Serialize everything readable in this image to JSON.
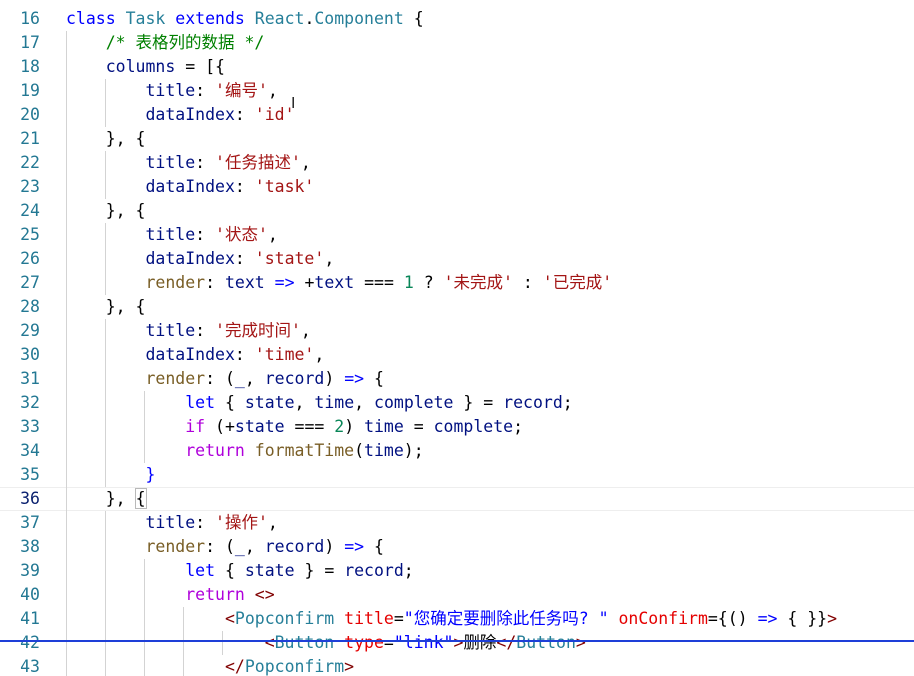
{
  "editor": {
    "cursor_glyph": "I",
    "lines": [
      {
        "n": "16",
        "current": false,
        "tokens": [
          {
            "t": "class ",
            "c": "t-kw"
          },
          {
            "t": "Task ",
            "c": "t-cls"
          },
          {
            "t": "extends ",
            "c": "t-kw"
          },
          {
            "t": "React",
            "c": "t-cls"
          },
          {
            "t": ".",
            "c": "t-p"
          },
          {
            "t": "Component",
            "c": "t-cls"
          },
          {
            "t": " {",
            "c": "t-p"
          }
        ]
      },
      {
        "n": "17",
        "current": false,
        "tokens": [
          {
            "t": "    ",
            "c": "t-p"
          },
          {
            "t": "/* 表格列的数据 */",
            "c": "t-cm"
          }
        ]
      },
      {
        "n": "18",
        "current": false,
        "tokens": [
          {
            "t": "    ",
            "c": "t-p"
          },
          {
            "t": "columns",
            "c": "t-prop"
          },
          {
            "t": " = [{",
            "c": "t-p"
          }
        ]
      },
      {
        "n": "19",
        "current": false,
        "tokens": [
          {
            "t": "        ",
            "c": "t-p"
          },
          {
            "t": "title",
            "c": "t-prop"
          },
          {
            "t": ": ",
            "c": "t-p"
          },
          {
            "t": "'编号'",
            "c": "t-str"
          },
          {
            "t": ",",
            "c": "t-p"
          }
        ]
      },
      {
        "n": "20",
        "current": false,
        "tokens": [
          {
            "t": "        ",
            "c": "t-p"
          },
          {
            "t": "dataIndex",
            "c": "t-prop"
          },
          {
            "t": ": ",
            "c": "t-p"
          },
          {
            "t": "'id'",
            "c": "t-str"
          }
        ]
      },
      {
        "n": "21",
        "current": false,
        "tokens": [
          {
            "t": "    ",
            "c": "t-p"
          },
          {
            "t": "}, {",
            "c": "t-p"
          }
        ]
      },
      {
        "n": "22",
        "current": false,
        "tokens": [
          {
            "t": "        ",
            "c": "t-p"
          },
          {
            "t": "title",
            "c": "t-prop"
          },
          {
            "t": ": ",
            "c": "t-p"
          },
          {
            "t": "'任务描述'",
            "c": "t-str"
          },
          {
            "t": ",",
            "c": "t-p"
          }
        ]
      },
      {
        "n": "23",
        "current": false,
        "tokens": [
          {
            "t": "        ",
            "c": "t-p"
          },
          {
            "t": "dataIndex",
            "c": "t-prop"
          },
          {
            "t": ": ",
            "c": "t-p"
          },
          {
            "t": "'task'",
            "c": "t-str"
          }
        ]
      },
      {
        "n": "24",
        "current": false,
        "tokens": [
          {
            "t": "    ",
            "c": "t-p"
          },
          {
            "t": "}, {",
            "c": "t-p"
          }
        ]
      },
      {
        "n": "25",
        "current": false,
        "tokens": [
          {
            "t": "        ",
            "c": "t-p"
          },
          {
            "t": "title",
            "c": "t-prop"
          },
          {
            "t": ": ",
            "c": "t-p"
          },
          {
            "t": "'状态'",
            "c": "t-str"
          },
          {
            "t": ",",
            "c": "t-p"
          }
        ]
      },
      {
        "n": "26",
        "current": false,
        "tokens": [
          {
            "t": "        ",
            "c": "t-p"
          },
          {
            "t": "dataIndex",
            "c": "t-prop"
          },
          {
            "t": ": ",
            "c": "t-p"
          },
          {
            "t": "'state'",
            "c": "t-str"
          },
          {
            "t": ",",
            "c": "t-p"
          }
        ]
      },
      {
        "n": "27",
        "current": false,
        "tokens": [
          {
            "t": "        ",
            "c": "t-p"
          },
          {
            "t": "render",
            "c": "t-fn"
          },
          {
            "t": ": ",
            "c": "t-p"
          },
          {
            "t": "text",
            "c": "t-prop"
          },
          {
            "t": " => ",
            "c": "t-kw"
          },
          {
            "t": "+",
            "c": "t-p"
          },
          {
            "t": "text",
            "c": "t-prop"
          },
          {
            "t": " === ",
            "c": "t-p"
          },
          {
            "t": "1",
            "c": "t-num"
          },
          {
            "t": " ? ",
            "c": "t-p"
          },
          {
            "t": "'未完成'",
            "c": "t-str"
          },
          {
            "t": " : ",
            "c": "t-p"
          },
          {
            "t": "'已完成'",
            "c": "t-str"
          }
        ]
      },
      {
        "n": "28",
        "current": false,
        "tokens": [
          {
            "t": "    ",
            "c": "t-p"
          },
          {
            "t": "}, {",
            "c": "t-p"
          }
        ]
      },
      {
        "n": "29",
        "current": false,
        "tokens": [
          {
            "t": "        ",
            "c": "t-p"
          },
          {
            "t": "title",
            "c": "t-prop"
          },
          {
            "t": ": ",
            "c": "t-p"
          },
          {
            "t": "'完成时间'",
            "c": "t-str"
          },
          {
            "t": ",",
            "c": "t-p"
          }
        ]
      },
      {
        "n": "30",
        "current": false,
        "tokens": [
          {
            "t": "        ",
            "c": "t-p"
          },
          {
            "t": "dataIndex",
            "c": "t-prop"
          },
          {
            "t": ": ",
            "c": "t-p"
          },
          {
            "t": "'time'",
            "c": "t-str"
          },
          {
            "t": ",",
            "c": "t-p"
          }
        ]
      },
      {
        "n": "31",
        "current": false,
        "tokens": [
          {
            "t": "        ",
            "c": "t-p"
          },
          {
            "t": "render",
            "c": "t-fn"
          },
          {
            "t": ": (",
            "c": "t-p"
          },
          {
            "t": "_",
            "c": "t-prop"
          },
          {
            "t": ", ",
            "c": "t-p"
          },
          {
            "t": "record",
            "c": "t-prop"
          },
          {
            "t": ") ",
            "c": "t-p"
          },
          {
            "t": "=>",
            "c": "t-kw"
          },
          {
            "t": " {",
            "c": "t-p"
          }
        ]
      },
      {
        "n": "32",
        "current": false,
        "tokens": [
          {
            "t": "            ",
            "c": "t-p"
          },
          {
            "t": "let",
            "c": "t-kw"
          },
          {
            "t": " { ",
            "c": "t-p"
          },
          {
            "t": "state",
            "c": "t-prop"
          },
          {
            "t": ", ",
            "c": "t-p"
          },
          {
            "t": "time",
            "c": "t-prop"
          },
          {
            "t": ", ",
            "c": "t-p"
          },
          {
            "t": "complete",
            "c": "t-prop"
          },
          {
            "t": " } = ",
            "c": "t-p"
          },
          {
            "t": "record",
            "c": "t-prop"
          },
          {
            "t": ";",
            "c": "t-p"
          }
        ]
      },
      {
        "n": "33",
        "current": false,
        "tokens": [
          {
            "t": "            ",
            "c": "t-p"
          },
          {
            "t": "if",
            "c": "t-flow"
          },
          {
            "t": " (+",
            "c": "t-p"
          },
          {
            "t": "state",
            "c": "t-prop"
          },
          {
            "t": " === ",
            "c": "t-p"
          },
          {
            "t": "2",
            "c": "t-num"
          },
          {
            "t": ") ",
            "c": "t-p"
          },
          {
            "t": "time",
            "c": "t-prop"
          },
          {
            "t": " = ",
            "c": "t-p"
          },
          {
            "t": "complete",
            "c": "t-prop"
          },
          {
            "t": ";",
            "c": "t-p"
          }
        ]
      },
      {
        "n": "34",
        "current": false,
        "tokens": [
          {
            "t": "            ",
            "c": "t-p"
          },
          {
            "t": "return",
            "c": "t-flow"
          },
          {
            "t": " ",
            "c": "t-p"
          },
          {
            "t": "formatTime",
            "c": "t-fn"
          },
          {
            "t": "(",
            "c": "t-p"
          },
          {
            "t": "time",
            "c": "t-prop"
          },
          {
            "t": ");",
            "c": "t-p"
          }
        ]
      },
      {
        "n": "35",
        "current": false,
        "tokens": [
          {
            "t": "        ",
            "c": "t-p"
          },
          {
            "t": "}",
            "c": "t-kw"
          }
        ]
      },
      {
        "n": "36",
        "current": true,
        "tokens": [
          {
            "t": "    ",
            "c": "t-p"
          },
          {
            "t": "}, ",
            "c": "t-p"
          },
          {
            "t": "{",
            "c": "t-p bracket-match"
          }
        ]
      },
      {
        "n": "37",
        "current": false,
        "tokens": [
          {
            "t": "        ",
            "c": "t-p"
          },
          {
            "t": "title",
            "c": "t-prop"
          },
          {
            "t": ": ",
            "c": "t-p"
          },
          {
            "t": "'操作'",
            "c": "t-str"
          },
          {
            "t": ",",
            "c": "t-p"
          }
        ]
      },
      {
        "n": "38",
        "current": false,
        "tokens": [
          {
            "t": "        ",
            "c": "t-p"
          },
          {
            "t": "render",
            "c": "t-fn"
          },
          {
            "t": ": (",
            "c": "t-p"
          },
          {
            "t": "_",
            "c": "t-prop"
          },
          {
            "t": ", ",
            "c": "t-p"
          },
          {
            "t": "record",
            "c": "t-prop"
          },
          {
            "t": ") ",
            "c": "t-p"
          },
          {
            "t": "=>",
            "c": "t-kw"
          },
          {
            "t": " {",
            "c": "t-p"
          }
        ]
      },
      {
        "n": "39",
        "current": false,
        "tokens": [
          {
            "t": "            ",
            "c": "t-p"
          },
          {
            "t": "let",
            "c": "t-kw"
          },
          {
            "t": " { ",
            "c": "t-p"
          },
          {
            "t": "state",
            "c": "t-prop"
          },
          {
            "t": " } = ",
            "c": "t-p"
          },
          {
            "t": "record",
            "c": "t-prop"
          },
          {
            "t": ";",
            "c": "t-p"
          }
        ]
      },
      {
        "n": "40",
        "current": false,
        "tokens": [
          {
            "t": "            ",
            "c": "t-p"
          },
          {
            "t": "return",
            "c": "t-flow"
          },
          {
            "t": " ",
            "c": "t-p"
          },
          {
            "t": "<>",
            "c": "t-tag"
          }
        ]
      },
      {
        "n": "41",
        "current": false,
        "tokens": [
          {
            "t": "                ",
            "c": "t-p"
          },
          {
            "t": "<",
            "c": "t-tag"
          },
          {
            "t": "Popconfirm",
            "c": "t-cls"
          },
          {
            "t": " ",
            "c": "t-p"
          },
          {
            "t": "title",
            "c": "t-attr"
          },
          {
            "t": "=",
            "c": "t-p"
          },
          {
            "t": "\"您确定要删除此任务吗? \"",
            "c": "t-attrstr"
          },
          {
            "t": " ",
            "c": "t-p"
          },
          {
            "t": "onConfirm",
            "c": "t-attr"
          },
          {
            "t": "={",
            "c": "t-p"
          },
          {
            "t": "() ",
            "c": "t-p"
          },
          {
            "t": "=>",
            "c": "t-kw"
          },
          {
            "t": " { }}",
            "c": "t-p"
          },
          {
            "t": ">",
            "c": "t-tag"
          }
        ]
      },
      {
        "n": "42",
        "current": false,
        "tokens": [
          {
            "t": "                    ",
            "c": "t-p"
          },
          {
            "t": "<",
            "c": "t-tag"
          },
          {
            "t": "Button",
            "c": "t-cls"
          },
          {
            "t": " ",
            "c": "t-p"
          },
          {
            "t": "type",
            "c": "t-attr"
          },
          {
            "t": "=",
            "c": "t-p"
          },
          {
            "t": "\"link\"",
            "c": "t-attrstr"
          },
          {
            "t": ">",
            "c": "t-tag"
          },
          {
            "t": "删除",
            "c": "t-p"
          },
          {
            "t": "</",
            "c": "t-tag"
          },
          {
            "t": "Button",
            "c": "t-cls"
          },
          {
            "t": ">",
            "c": "t-tag"
          }
        ]
      },
      {
        "n": "43",
        "current": false,
        "tokens": [
          {
            "t": "                ",
            "c": "t-p"
          },
          {
            "t": "</",
            "c": "t-tag"
          },
          {
            "t": "Popconfirm",
            "c": "t-cls"
          },
          {
            "t": ">",
            "c": "t-tag"
          }
        ]
      }
    ]
  }
}
